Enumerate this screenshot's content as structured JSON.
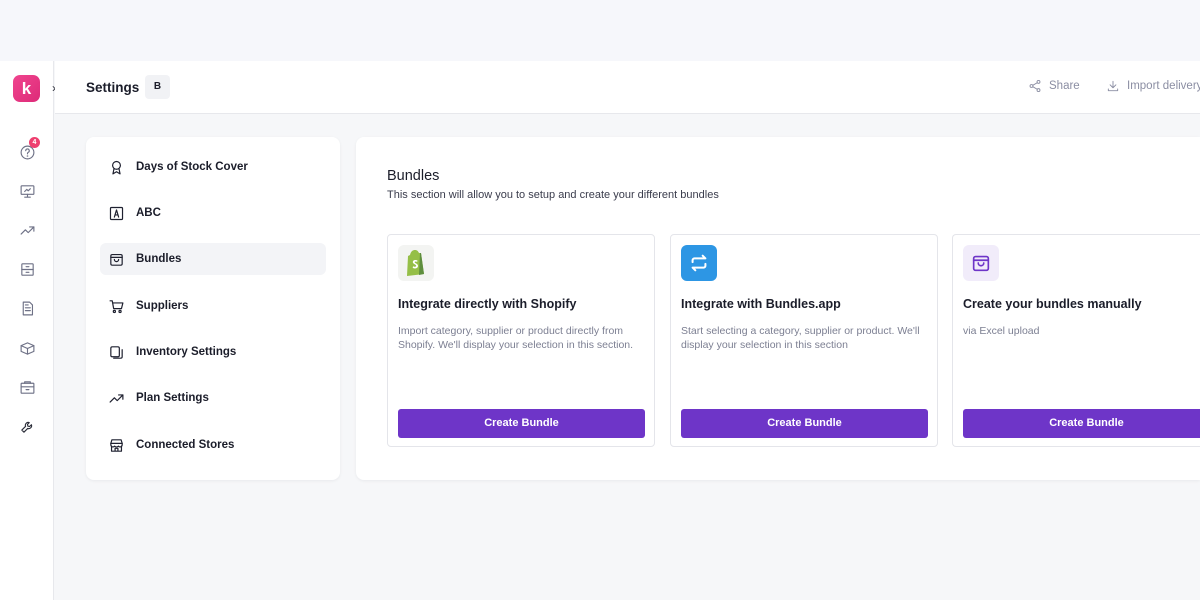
{
  "app": {
    "logo_letter": "k",
    "accent": "#6e35c8",
    "brand": "#e8357f"
  },
  "rail": {
    "help_badge": "4",
    "icons": [
      "help-circle-icon",
      "presentation-icon",
      "trend-up-icon",
      "archive-icon",
      "document-icon",
      "box-icon",
      "inventory-icon",
      "wrench-icon"
    ]
  },
  "header": {
    "title": "Settings",
    "chip": "B",
    "share_label": "Share",
    "import_label": "Import delivery"
  },
  "settings_menu": {
    "items": [
      {
        "label": "Days of Stock Cover",
        "icon": "award-icon"
      },
      {
        "label": "ABC",
        "icon": "abc-box-icon"
      },
      {
        "label": "Bundles",
        "icon": "bag-icon",
        "active": true
      },
      {
        "label": "Suppliers",
        "icon": "cart-icon"
      },
      {
        "label": "Inventory Settings",
        "icon": "copy-icon"
      },
      {
        "label": "Plan Settings",
        "icon": "trend-up-icon"
      },
      {
        "label": "Connected Stores",
        "icon": "store-icon"
      }
    ]
  },
  "bundles": {
    "title": "Bundles",
    "description": "This section will allow you to setup and create your different bundles",
    "options": [
      {
        "title": "Integrate directly with Shopify",
        "description": "Import category, supplier or product directly from Shopify. We'll display your selection in this section.",
        "button": "Create Bundle",
        "icon": "shopify-icon"
      },
      {
        "title": "Integrate with Bundles.app",
        "description": "Start selecting a category, supplier or product. We'll display your selection in this section",
        "button": "Create Bundle",
        "icon": "bundles-app-icon"
      },
      {
        "title": "Create your bundles manually",
        "description": "via Excel upload",
        "button": "Create Bundle",
        "icon": "bag-icon"
      }
    ]
  }
}
